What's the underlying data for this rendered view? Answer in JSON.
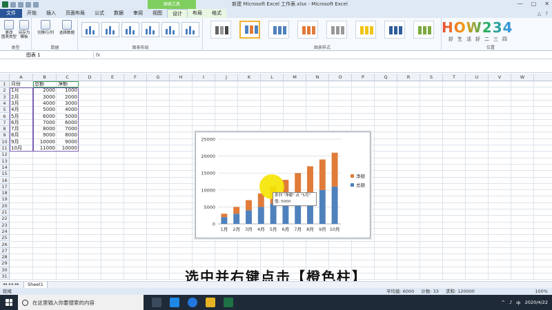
{
  "window": {
    "title": "新建 Microsoft Excel 工作表.xlsx - Microsoft Excel",
    "context_tab_title": "图表工具",
    "controls": [
      "—",
      "▢",
      "✕"
    ]
  },
  "tabs": [
    {
      "label": "文件"
    },
    {
      "label": "开始"
    },
    {
      "label": "插入"
    },
    {
      "label": "页面布局"
    },
    {
      "label": "公式"
    },
    {
      "label": "数据"
    },
    {
      "label": "审阅"
    },
    {
      "label": "视图"
    },
    {
      "label": "设计"
    },
    {
      "label": "布局"
    },
    {
      "label": "格式"
    }
  ],
  "ribbon": {
    "change_type": "更改\n图表类型",
    "save_template": "另存为\n模板",
    "switch_rowcol": "切换行/列",
    "select_data": "选择数据",
    "group_type": "类型",
    "group_data": "数据",
    "group_layout": "图表布局",
    "group_styles": "图表样式",
    "group_position": "位置"
  },
  "watermark": {
    "brand": "HOW234",
    "slogan": "好生活好二三四"
  },
  "formula_bar": {
    "name_box": "图表 1",
    "fx": "fx",
    "formula": ""
  },
  "columns": [
    "A",
    "B",
    "C",
    "D",
    "E",
    "F",
    "G",
    "H",
    "I",
    "J",
    "K",
    "L",
    "M",
    "N",
    "O",
    "P",
    "Q",
    "R",
    "S",
    "T",
    "U",
    "V",
    "W"
  ],
  "rows": [
    "1",
    "2",
    "3",
    "4",
    "5",
    "6",
    "7",
    "8",
    "9",
    "10",
    "11",
    "12",
    "13",
    "14",
    "15",
    "16",
    "17",
    "18",
    "19",
    "20",
    "21",
    "22",
    "23",
    "24",
    "25",
    "26",
    "27",
    "28",
    "29",
    "30",
    "31"
  ],
  "table": {
    "headers": [
      "月份",
      "总额",
      "净额"
    ],
    "rows": [
      [
        "1月",
        "2000",
        "1000"
      ],
      [
        "2月",
        "3000",
        "2000"
      ],
      [
        "3月",
        "4000",
        "3000"
      ],
      [
        "4月",
        "5000",
        "4000"
      ],
      [
        "5月",
        "6000",
        "5000"
      ],
      [
        "6月",
        "7000",
        "6000"
      ],
      [
        "7月",
        "8000",
        "7000"
      ],
      [
        "8月",
        "9000",
        "8000"
      ],
      [
        "9月",
        "10000",
        "9000"
      ],
      [
        "10月",
        "11000",
        "10000"
      ]
    ]
  },
  "chart_data": {
    "type": "bar",
    "stacked": true,
    "categories": [
      "1月",
      "2月",
      "3月",
      "4月",
      "5月",
      "6月",
      "7月",
      "8月",
      "9月",
      "10月"
    ],
    "series": [
      {
        "name": "总额",
        "values": [
          2000,
          3000,
          4000,
          5000,
          6000,
          7000,
          8000,
          9000,
          10000,
          11000
        ],
        "color": "#4f81bd"
      },
      {
        "name": "净额",
        "values": [
          1000,
          2000,
          3000,
          4000,
          5000,
          6000,
          7000,
          8000,
          9000,
          10000
        ],
        "color": "#e07b39"
      }
    ],
    "ylim": [
      0,
      25000
    ],
    "yticks": [
      "0",
      "5000",
      "10000",
      "15000",
      "20000",
      "25000"
    ],
    "legend_position": "right",
    "grid": true
  },
  "tooltip": {
    "line1": "系列 \"净额\" 点 \"5月\"",
    "line2": "值: 5000"
  },
  "subtitle": "选中并右键点击【橙色柱】",
  "sheet": {
    "tab": "Sheet1"
  },
  "status": {
    "mode": "就绪",
    "average": "平均值: 6000",
    "count": "计数: 33",
    "sum": "求和: 120000",
    "zoom": "100%"
  },
  "taskbar": {
    "search_placeholder": "在这里输入你要搜索的内容",
    "time": "",
    "date": "2020/4/22"
  }
}
